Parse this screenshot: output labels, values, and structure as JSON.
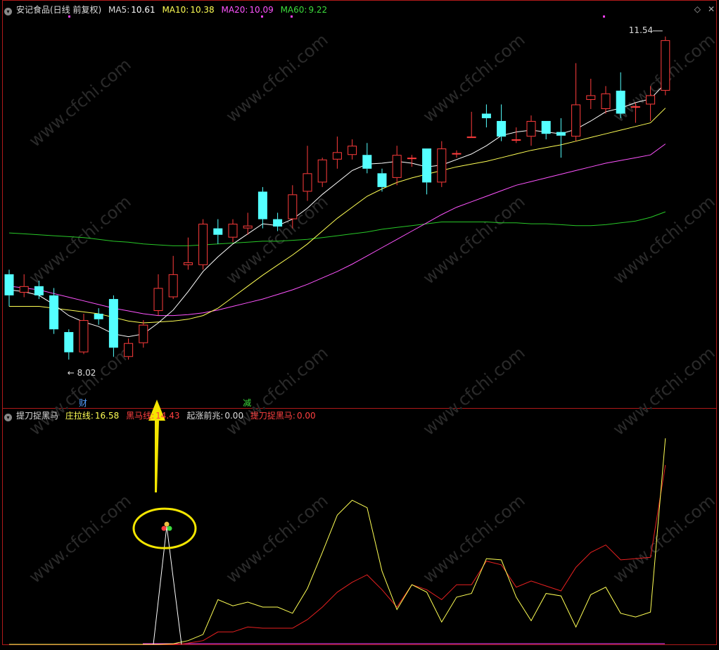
{
  "main_header": {
    "title": "安记食品(日线 前复权)",
    "ma5_label": "MA5:",
    "ma5_value": "10.61",
    "ma10_label": "MA10:",
    "ma10_value": "10.38",
    "ma20_label": "MA20:",
    "ma20_value": "10.09",
    "ma60_label": "MA60:",
    "ma60_value": "9.22"
  },
  "indicator_header": {
    "name": "提刀捉黑马",
    "zhuang_label": "庄拉线:",
    "zhuang_value": "16.58",
    "heima_label": "黑马线:",
    "heima_value": "14.43",
    "qizhang_label": "起涨前兆:",
    "qizhang_value": "0.00",
    "tidao_label": "提刀捉黑马:",
    "tidao_value": "0.00"
  },
  "window_controls": {
    "collapse": "◇",
    "close": "✕"
  },
  "annotations": {
    "high_label": "11.54",
    "low_label": "8.02",
    "marker_cai": "财",
    "marker_jian": "减",
    "watermark": "www.cfchi.com"
  },
  "colors": {
    "up": "#ff3c3c",
    "down": "#54ffff",
    "ma5": "#ffffff",
    "ma10": "#ffff54",
    "ma20": "#ff54ff",
    "ma60": "#28c828",
    "zhuang": "#ffff54",
    "heima": "#e82020",
    "frame": "#b01a1a",
    "highlight": "#f4e600"
  },
  "chart_data": [
    {
      "type": "candlestick",
      "title": "安记食品(日线 前复权)",
      "ylim": [
        7.6,
        11.8
      ],
      "candles": [
        {
          "o": 8.95,
          "c": 8.72,
          "h": 9.0,
          "l": 8.6
        },
        {
          "o": 8.75,
          "c": 8.82,
          "h": 8.95,
          "l": 8.7
        },
        {
          "o": 8.82,
          "c": 8.72,
          "h": 8.88,
          "l": 8.68
        },
        {
          "o": 8.72,
          "c": 8.35,
          "h": 8.8,
          "l": 8.3
        },
        {
          "o": 8.32,
          "c": 8.1,
          "h": 8.35,
          "l": 8.02
        },
        {
          "o": 8.1,
          "c": 8.45,
          "h": 8.52,
          "l": 8.08
        },
        {
          "o": 8.52,
          "c": 8.46,
          "h": 8.58,
          "l": 8.4
        },
        {
          "o": 8.68,
          "c": 8.15,
          "h": 8.72,
          "l": 8.05
        },
        {
          "o": 8.05,
          "c": 8.2,
          "h": 8.25,
          "l": 8.02
        },
        {
          "o": 8.2,
          "c": 8.4,
          "h": 8.45,
          "l": 8.15
        },
        {
          "o": 8.55,
          "c": 8.8,
          "h": 8.95,
          "l": 8.5
        },
        {
          "o": 8.7,
          "c": 8.95,
          "h": 9.15,
          "l": 8.68
        },
        {
          "o": 9.05,
          "c": 9.08,
          "h": 9.35,
          "l": 9.0
        },
        {
          "o": 9.05,
          "c": 9.5,
          "h": 9.55,
          "l": 9.0
        },
        {
          "o": 9.45,
          "c": 9.38,
          "h": 9.55,
          "l": 9.28
        },
        {
          "o": 9.35,
          "c": 9.5,
          "h": 9.55,
          "l": 9.3
        },
        {
          "o": 9.45,
          "c": 9.48,
          "h": 9.62,
          "l": 9.38
        },
        {
          "o": 9.85,
          "c": 9.55,
          "h": 9.9,
          "l": 9.45
        },
        {
          "o": 9.55,
          "c": 9.47,
          "h": 9.62,
          "l": 9.42
        },
        {
          "o": 9.55,
          "c": 9.82,
          "h": 9.92,
          "l": 9.45
        },
        {
          "o": 9.85,
          "c": 10.05,
          "h": 10.35,
          "l": 9.75
        },
        {
          "o": 9.95,
          "c": 10.2,
          "h": 10.22,
          "l": 9.9
        },
        {
          "o": 10.2,
          "c": 10.28,
          "h": 10.45,
          "l": 10.1
        },
        {
          "o": 10.25,
          "c": 10.35,
          "h": 10.42,
          "l": 10.2
        },
        {
          "o": 10.25,
          "c": 10.1,
          "h": 10.38,
          "l": 10.05
        },
        {
          "o": 10.05,
          "c": 9.9,
          "h": 10.1,
          "l": 9.85
        },
        {
          "o": 10.0,
          "c": 10.25,
          "h": 10.35,
          "l": 9.92
        },
        {
          "o": 10.22,
          "c": 10.22,
          "h": 10.25,
          "l": 10.12
        },
        {
          "o": 10.32,
          "c": 9.95,
          "h": 10.32,
          "l": 9.82
        },
        {
          "o": 9.95,
          "c": 10.32,
          "h": 10.4,
          "l": 9.9
        },
        {
          "o": 10.27,
          "c": 10.27,
          "h": 10.3,
          "l": 10.22
        },
        {
          "o": 10.45,
          "c": 10.45,
          "h": 10.72,
          "l": 10.45
        },
        {
          "o": 10.7,
          "c": 10.65,
          "h": 10.8,
          "l": 10.55
        },
        {
          "o": 10.62,
          "c": 10.45,
          "h": 10.8,
          "l": 10.4
        },
        {
          "o": 10.42,
          "c": 10.42,
          "h": 10.55,
          "l": 10.38
        },
        {
          "o": 10.45,
          "c": 10.62,
          "h": 10.68,
          "l": 10.35
        },
        {
          "o": 10.62,
          "c": 10.48,
          "h": 10.62,
          "l": 10.42
        },
        {
          "o": 10.5,
          "c": 10.46,
          "h": 10.65,
          "l": 10.22
        },
        {
          "o": 10.45,
          "c": 10.8,
          "h": 11.25,
          "l": 10.4
        },
        {
          "o": 10.85,
          "c": 10.9,
          "h": 11.08,
          "l": 10.75
        },
        {
          "o": 10.75,
          "c": 10.92,
          "h": 11.0,
          "l": 10.7
        },
        {
          "o": 10.95,
          "c": 10.7,
          "h": 11.15,
          "l": 10.65
        },
        {
          "o": 10.78,
          "c": 10.78,
          "h": 10.82,
          "l": 10.6
        },
        {
          "o": 10.8,
          "c": 10.9,
          "h": 11.0,
          "l": 10.62
        },
        {
          "o": 10.95,
          "c": 11.5,
          "h": 11.54,
          "l": 10.9
        }
      ],
      "ma5": [
        8.78,
        8.76,
        8.72,
        8.62,
        8.5,
        8.43,
        8.38,
        8.3,
        8.27,
        8.3,
        8.42,
        8.56,
        8.76,
        8.98,
        9.14,
        9.28,
        9.39,
        9.5,
        9.48,
        9.55,
        9.67,
        9.82,
        9.95,
        10.08,
        10.15,
        10.16,
        10.18,
        10.16,
        10.12,
        10.14,
        10.2,
        10.26,
        10.35,
        10.46,
        10.5,
        10.52,
        10.5,
        10.48,
        10.53,
        10.62,
        10.72,
        10.76,
        10.82,
        10.86,
        11.03
      ],
      "ma10": [
        8.6,
        8.6,
        8.6,
        8.58,
        8.56,
        8.54,
        8.52,
        8.48,
        8.44,
        8.42,
        8.43,
        8.44,
        8.46,
        8.5,
        8.58,
        8.7,
        8.82,
        8.94,
        9.05,
        9.16,
        9.28,
        9.42,
        9.56,
        9.68,
        9.8,
        9.88,
        9.95,
        10.0,
        10.04,
        10.08,
        10.12,
        10.15,
        10.18,
        10.22,
        10.26,
        10.3,
        10.33,
        10.36,
        10.4,
        10.44,
        10.48,
        10.52,
        10.56,
        10.6,
        10.76
      ],
      "ma20": [
        8.82,
        8.8,
        8.78,
        8.74,
        8.7,
        8.66,
        8.62,
        8.58,
        8.55,
        8.52,
        8.5,
        8.5,
        8.51,
        8.53,
        8.56,
        8.6,
        8.64,
        8.68,
        8.73,
        8.78,
        8.84,
        8.91,
        8.98,
        9.06,
        9.15,
        9.24,
        9.33,
        9.42,
        9.51,
        9.6,
        9.68,
        9.74,
        9.8,
        9.86,
        9.92,
        9.96,
        10.0,
        10.04,
        10.08,
        10.12,
        10.16,
        10.19,
        10.22,
        10.25,
        10.37
      ],
      "ma60": [
        9.4,
        9.39,
        9.38,
        9.37,
        9.36,
        9.35,
        9.33,
        9.31,
        9.3,
        9.28,
        9.27,
        9.26,
        9.26,
        9.27,
        9.28,
        9.29,
        9.3,
        9.31,
        9.31,
        9.32,
        9.33,
        9.35,
        9.37,
        9.39,
        9.41,
        9.44,
        9.46,
        9.48,
        9.5,
        9.52,
        9.52,
        9.52,
        9.52,
        9.51,
        9.51,
        9.5,
        9.5,
        9.49,
        9.48,
        9.48,
        9.49,
        9.51,
        9.53,
        9.57,
        9.63
      ],
      "high": 11.54,
      "low": 8.02
    },
    {
      "type": "line",
      "title": "提刀捉黑马",
      "ylim": [
        0,
        18
      ],
      "series": [
        {
          "name": "庄拉线",
          "values": [
            0,
            0,
            0,
            0,
            0,
            0,
            0,
            0,
            0,
            0,
            0,
            0.05,
            0.3,
            0.8,
            3.6,
            3.1,
            3.4,
            3.0,
            3.0,
            2.5,
            4.5,
            7.4,
            10.4,
            11.6,
            11.0,
            5.9,
            2.8,
            4.8,
            4.2,
            1.8,
            3.8,
            4.1,
            6.9,
            6.8,
            3.8,
            1.9,
            4.1,
            3.9,
            1.4,
            4.0,
            4.6,
            2.5,
            2.2,
            2.6,
            16.58
          ]
        },
        {
          "name": "黑马线",
          "values": [
            0,
            0,
            0,
            0,
            0,
            0,
            0,
            0,
            0,
            0,
            0,
            0,
            0.1,
            0.3,
            1.0,
            1.0,
            1.4,
            1.3,
            1.3,
            1.3,
            2.0,
            3.0,
            4.2,
            5.0,
            5.6,
            4.4,
            3.0,
            4.8,
            4.4,
            3.6,
            4.8,
            4.8,
            6.7,
            6.4,
            4.6,
            5.1,
            4.7,
            4.3,
            6.2,
            7.4,
            8.0,
            6.8,
            6.9,
            7.0,
            14.43
          ]
        },
        {
          "name": "起涨前兆",
          "values": [
            0,
            0,
            0,
            0,
            0,
            0,
            0,
            0,
            0,
            0,
            0,
            0,
            0,
            0,
            0,
            0,
            0,
            0,
            0,
            0,
            0,
            0,
            0,
            0,
            0,
            0,
            0,
            0,
            0,
            0,
            0,
            0,
            0,
            0,
            0,
            0,
            0,
            0,
            0,
            0,
            0,
            0,
            0,
            0,
            0
          ]
        },
        {
          "name": "提刀捉黑马",
          "values": [
            0,
            0,
            0,
            0,
            0,
            0,
            0,
            0,
            0,
            0,
            0,
            0,
            0,
            0,
            0,
            0,
            0,
            0,
            0,
            0,
            0,
            0,
            0,
            0,
            0,
            0,
            0,
            0,
            0,
            0,
            0,
            0,
            0,
            0,
            0,
            0,
            0,
            0,
            0,
            0,
            0,
            0,
            0,
            0,
            0
          ]
        }
      ],
      "signal": {
        "index": 10,
        "peak": 9.5
      }
    }
  ]
}
